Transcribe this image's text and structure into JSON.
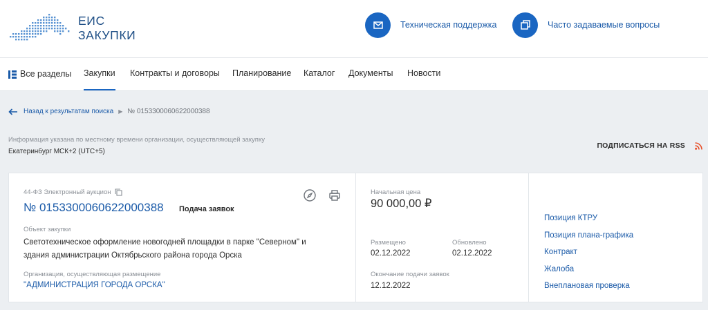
{
  "header": {
    "logo_line1": "ЕИС",
    "logo_line2": "ЗАКУПКИ",
    "support_label": "Техническая поддержка",
    "faq_label": "Часто задаваемые вопросы"
  },
  "nav": {
    "items": [
      {
        "label": "Все разделы"
      },
      {
        "label": "Закупки"
      },
      {
        "label": "Контракты и договоры"
      },
      {
        "label": "Планирование"
      },
      {
        "label": "Каталог"
      },
      {
        "label": "Документы"
      },
      {
        "label": "Новости"
      }
    ],
    "active": "Закупки"
  },
  "breadcrumb": {
    "back_label": "Назад к результатам поиска",
    "current": "№ 0153300060622000388"
  },
  "info_note": "Информация указана по местному времени организации, осуществляющей закупку",
  "timezone": "Екатеринбург МСК+2 (UTC+5)",
  "rss_label": "ПОДПИСАТЬСЯ НА RSS",
  "card": {
    "law": "44-ФЗ Электронный аукцион",
    "reg_number": "№ 0153300060622000388",
    "stage": "Подача заявок",
    "object_label": "Объект закупки",
    "object_text": "Светотехническое оформление новогодней площадки в парке \"Северном\" и здания администрации Октябрьского района города Орска",
    "org_label": "Организация, осуществляющая размещение",
    "org_name": "\"АДМИНИСТРАЦИЯ ГОРОДА ОРСКА\"",
    "price_label": "Начальная цена",
    "price": "90 000,00 ₽",
    "placed_label": "Размещено",
    "placed_date": "02.12.2022",
    "updated_label": "Обновлено",
    "updated_date": "02.12.2022",
    "deadline_label": "Окончание подачи заявок",
    "deadline_date": "12.12.2022",
    "links": [
      {
        "label": "Позиция КТРУ"
      },
      {
        "label": "Позиция плана-графика"
      },
      {
        "label": "Контракт"
      },
      {
        "label": "Жалоба"
      },
      {
        "label": "Внеплановая проверка"
      }
    ]
  },
  "icons": {
    "support": "mail-icon",
    "faq": "windows-icon",
    "nav_all": "sections-icon",
    "back": "arrow-left-icon",
    "copy": "copy-icon",
    "compass": "compass-icon",
    "print": "print-icon",
    "rss": "rss-icon"
  },
  "colors": {
    "accent": "#1a66c2",
    "link": "#1a5aa8",
    "rss": "#e8502a"
  }
}
